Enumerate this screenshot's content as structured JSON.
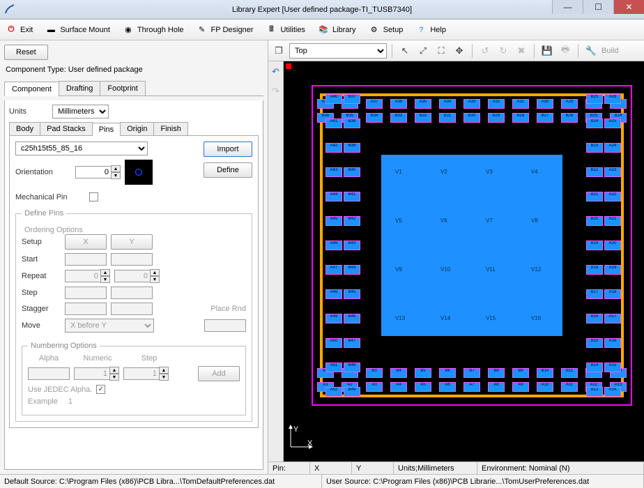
{
  "window": {
    "title": "Library Expert [User defined package-TI_TUSB7340]"
  },
  "menubar": {
    "exit": "Exit",
    "surface_mount": "Surface Mount",
    "through_hole": "Through Hole",
    "fp_designer": "FP Designer",
    "utilities": "Utilities",
    "library": "Library",
    "setup": "Setup",
    "help": "Help"
  },
  "left": {
    "reset": "Reset",
    "component_type_label": "Component Type:",
    "component_type_value": "User defined package",
    "tabs": {
      "component": "Component",
      "drafting": "Drafting",
      "footprint": "Footprint"
    },
    "units_label": "Units",
    "units_value": "Millimeters",
    "subtabs": {
      "body": "Body",
      "padstacks": "Pad Stacks",
      "pins": "Pins",
      "origin": "Origin",
      "finish": "Finish"
    },
    "pin_shape": "c25h15t55_85_16",
    "import": "Import",
    "define": "Define",
    "orientation_label": "Orientation",
    "orientation_value": "0",
    "mechanical_pin_label": "Mechanical Pin",
    "define_pins_legend": "Define Pins",
    "ordering_legend": "Ordering Options",
    "setup_label": "Setup",
    "start_label": "Start",
    "repeat_label": "Repeat",
    "x_btn": "X",
    "y_btn": "Y",
    "repeat_x": "0",
    "repeat_y": "0",
    "step_label": "Step",
    "stagger_label": "Stagger",
    "move_label": "Move",
    "move_value": "X before Y",
    "place_rnd": "Place Rnd",
    "numbering_legend": "Numbering Options",
    "alpha_label": "Alpha",
    "numeric_label": "Numeric",
    "num_step_label": "Step",
    "numeric_value": "1",
    "num_step_value": "1",
    "add_btn": "Add",
    "jedec_label": "Use JEDEC Alpha.",
    "example_label": "Example",
    "example_value": "1"
  },
  "tooltop": {
    "layer": "Top",
    "build": "Build"
  },
  "status": {
    "pin": "Pin:",
    "x": "X",
    "y": "Y",
    "units": "Units;Millimeters",
    "env": "Environment: Nominal (N)"
  },
  "bottom": {
    "default_src": "Default Source:  C:\\Program Files (x86)\\PCB Libra...\\TomDefaultPreferences.dat",
    "user_src": "User Source:  C:\\Program Files (x86)\\PCB Librarie...\\TomUserPreferences.dat"
  },
  "viewer": {
    "inner_labels": [
      "V1",
      "V2",
      "V3",
      "V4",
      "V5",
      "V6",
      "V7",
      "V8",
      "V9",
      "V10",
      "V11",
      "V12",
      "V13",
      "V14",
      "V15",
      "V16"
    ]
  }
}
